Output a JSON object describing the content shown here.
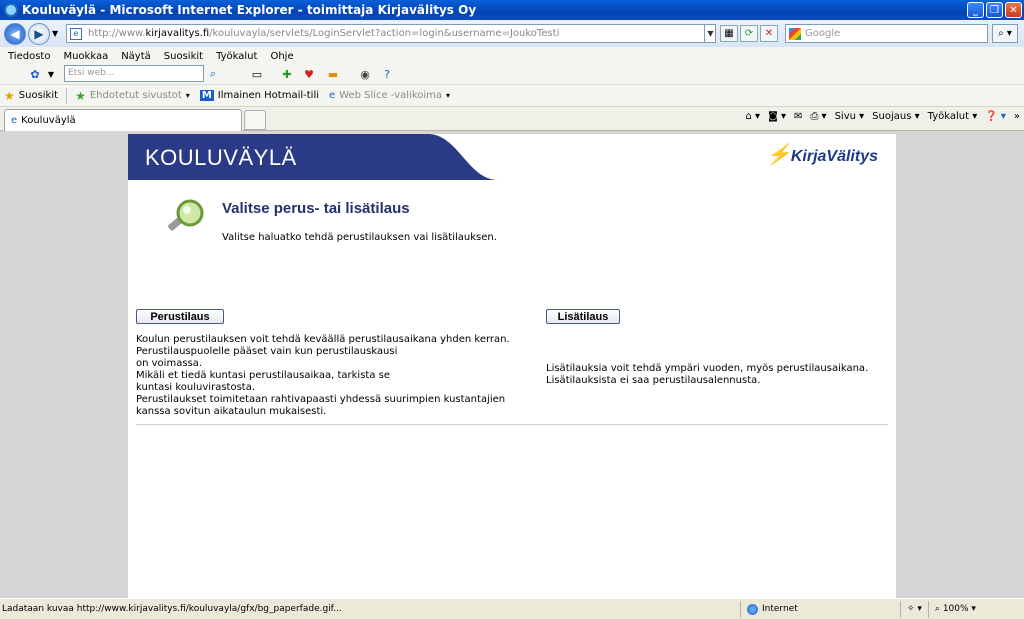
{
  "window": {
    "title": "Kouluväylä - Microsoft Internet Explorer - toimittaja Kirjavälitys Oy"
  },
  "address": {
    "url_prefix": "http://www.",
    "url_domain": "kirjavalitys.fi",
    "url_rest": "/kouluvayla/servlets/LoginServlet?action=login&username=JoukoTesti"
  },
  "search": {
    "placeholder": "Google",
    "web_placeholder": "Etsi web..."
  },
  "menu": {
    "items": [
      "Tiedosto",
      "Muokkaa",
      "Näytä",
      "Suosikit",
      "Työkalut",
      "Ohje"
    ]
  },
  "favorites": {
    "label": "Suosikit",
    "suggested": "Ehdotetut sivustot",
    "hotmail": "Ilmainen Hotmail-tili",
    "webslice": "Web Slice -valikoima"
  },
  "tab": {
    "title": "Kouluväylä"
  },
  "commands": {
    "page": "Sivu",
    "safety": "Suojaus",
    "tools": "Työkalut"
  },
  "page": {
    "banner_title": "KOULUVÄYLÄ",
    "logo_text": "KirjaVälitys",
    "heading": "Valitse perus- tai lisätilaus",
    "subtext": "Valitse haluatko tehdä perustilauksen vai lisätilauksen.",
    "left": {
      "button": "Perustilaus",
      "lines": [
        "Koulun perustilauksen voit tehdä keväällä perustilausaikana yhden kerran.",
        "Perustilauspuolelle pääset vain kun perustilauskausi",
        "on voimassa.",
        "Mikäli et tiedä kuntasi perustilausaikaa, tarkista se",
        "kuntasi kouluvirastosta.",
        "Perustilaukset toimitetaan rahtivapaasti yhdessä suurimpien kustantajien",
        "kanssa sovitun aikataulun mukaisesti."
      ]
    },
    "right": {
      "button": "Lisätilaus",
      "lines": [
        "Lisätilauksia voit tehdä ympäri vuoden, myös perustilausaikana.",
        "Lisätilauksista ei saa perustilausalennusta."
      ]
    }
  },
  "status": {
    "text": "Ladataan kuvaa http://www.kirjavalitys.fi/kouluvayla/gfx/bg_paperfade.gif...",
    "zone": "Internet",
    "zoom": "100%"
  },
  "colors": {
    "banner": "#2b3a86",
    "heading": "#26306e"
  }
}
